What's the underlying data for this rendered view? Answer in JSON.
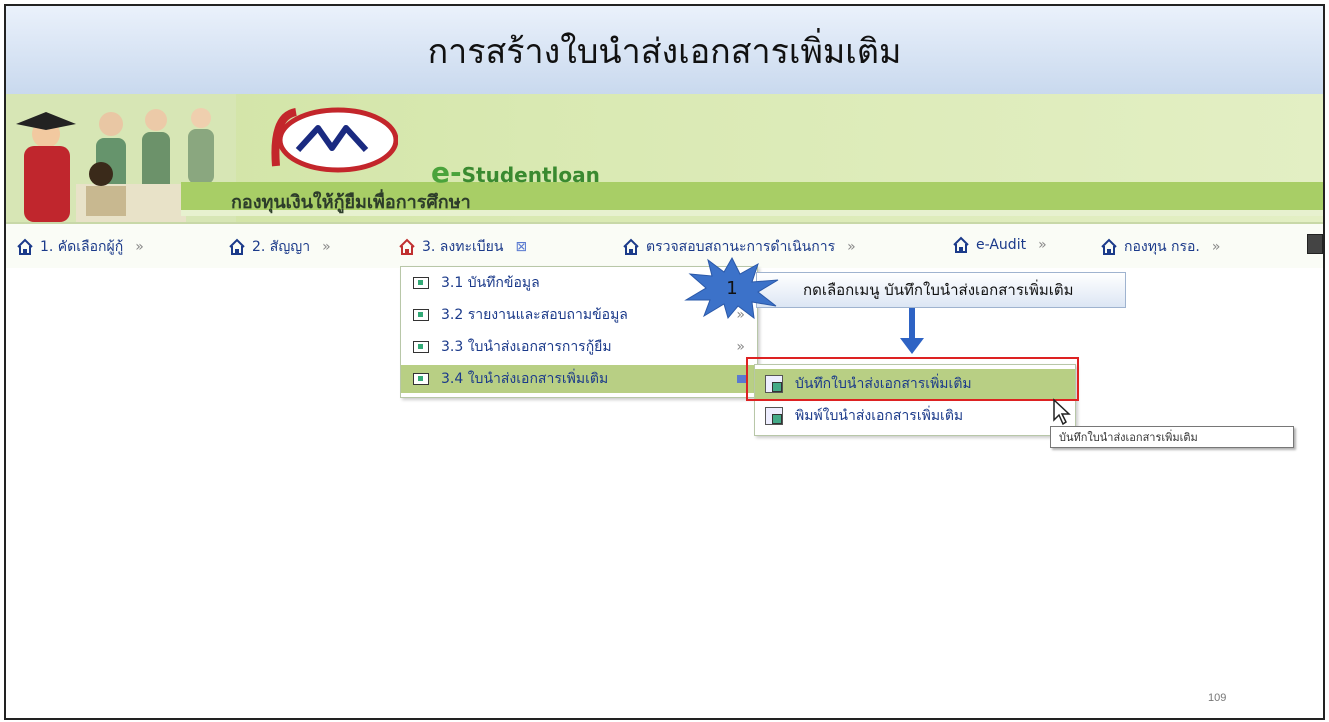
{
  "slide": {
    "title": "การสร้างใบนำส่งเอกสารเพิ่มเติม",
    "page_number": "109"
  },
  "banner": {
    "brand": "Studentloan",
    "brand_prefix": "e-",
    "slogan": "กองทุนเงินให้กู้ยืมเพื่อการศึกษา",
    "colors": {
      "banner_green": "#cfe2a2",
      "stripe": "#a8ce66"
    }
  },
  "nav": {
    "items": [
      {
        "label": "1. คัดเลือกผู้กู้",
        "sep": "»"
      },
      {
        "label": "2. สัญญา",
        "sep": "»"
      },
      {
        "label": "3. ลงทะเบียน",
        "sep": "⊠"
      },
      {
        "label": "ตรวจสอบสถานะการดำเนินการ",
        "sep": "»"
      },
      {
        "label": "e-Audit",
        "sep": "»"
      },
      {
        "label": "กองทุน กรอ.",
        "sep": "»"
      }
    ]
  },
  "submenu": {
    "items": [
      {
        "label": "3.1 บันทึกข้อมูล",
        "arrow": ""
      },
      {
        "label": "3.2 รายงานและสอบถามข้อมูล",
        "arrow": "»"
      },
      {
        "label": "3.3 ใบนำส่งเอกสารการกู้ยืม",
        "arrow": "»"
      },
      {
        "label": "3.4 ใบนำส่งเอกสารเพิ่มเติม",
        "arrow": ""
      }
    ]
  },
  "submenu2": {
    "items": [
      {
        "label": "บันทึกใบนำส่งเอกสารเพิ่มเติม"
      },
      {
        "label": "พิมพ์ใบนำส่งเอกสารเพิ่มเติม"
      }
    ]
  },
  "annotation": {
    "step": "1",
    "text": "กดเลือกเมนู บันทึกใบนำส่งเอกสารเพิ่มเติม"
  },
  "tooltip": {
    "text": "บันทึกใบนำส่งเอกสารเพิ่มเติม"
  }
}
